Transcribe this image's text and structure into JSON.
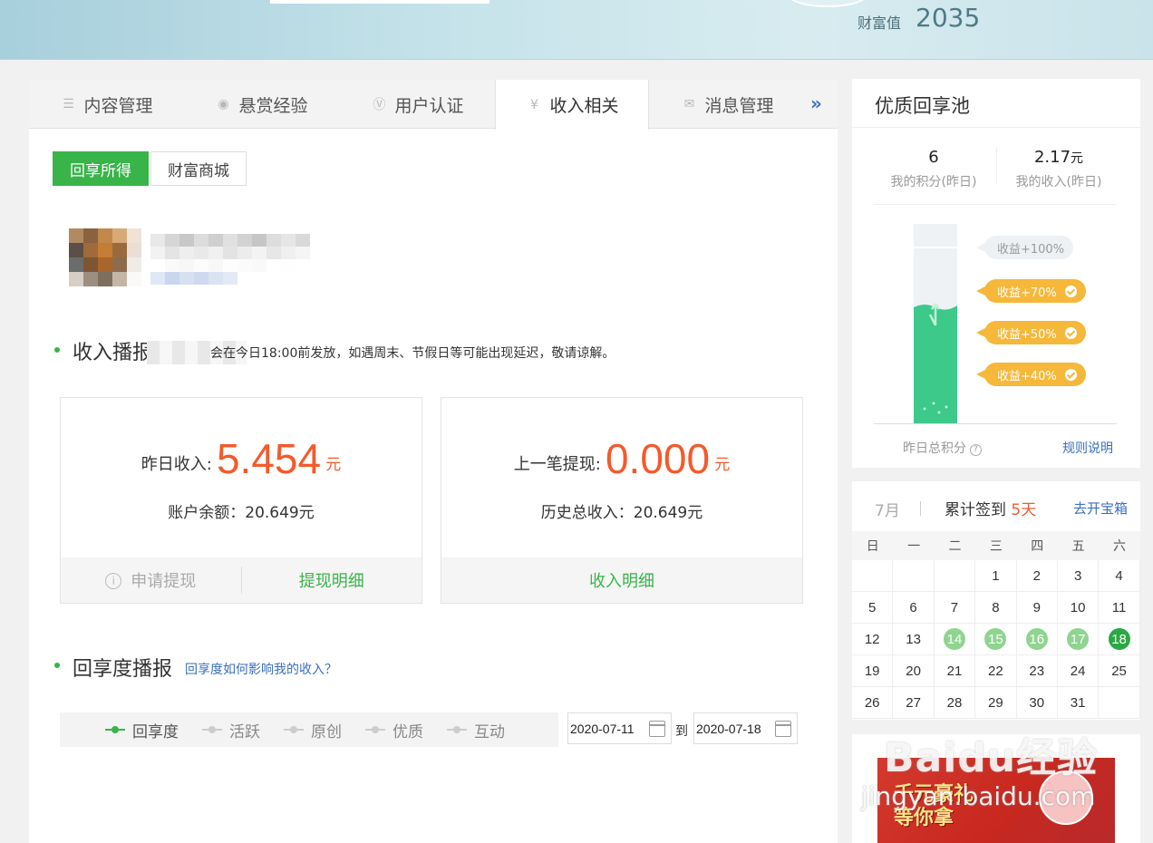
{
  "header": {
    "wealth_label": "财富值",
    "wealth_value": "2035"
  },
  "tabs": [
    {
      "label": "内容管理",
      "icon": "list-icon"
    },
    {
      "label": "悬赏经验",
      "icon": "bounty-icon"
    },
    {
      "label": "用户认证",
      "icon": "verify-icon"
    },
    {
      "label": "收入相关",
      "icon": "yen-icon",
      "active": true
    },
    {
      "label": "消息管理",
      "icon": "mail-icon"
    }
  ],
  "subtabs": {
    "earnings": "回享所得",
    "mall": "财富商城"
  },
  "income_section": {
    "title": "收入播报",
    "note": "会在今日18:00前发放，如遇周末、节假日等可能出现延迟，敬请谅解。"
  },
  "card_left": {
    "label": "昨日收入:",
    "value": "5.454",
    "unit": "元",
    "sub": "账户余额：20.649元",
    "btn_withdraw": "申请提现",
    "btn_detail": "提现明细"
  },
  "card_right": {
    "label": "上一笔提现:",
    "value": "0.000",
    "unit": "元",
    "sub": "历史总收入：20.649元",
    "btn_detail": "收入明细"
  },
  "degree_section": {
    "title": "回享度播报",
    "link": "回享度如何影响我的收入？"
  },
  "metrics": [
    "回享度",
    "活跃",
    "原创",
    "优质",
    "互动"
  ],
  "date_range": {
    "from": "2020-07-11",
    "to_label": "到",
    "to": "2020-07-18"
  },
  "pool": {
    "title": "优质回享池",
    "points_value": "6",
    "points_label": "我的积分(昨日)",
    "income_value": "2.17",
    "income_unit": "元",
    "income_label": "我的收入(昨日)",
    "fill_percent": 60,
    "tiers": [
      "收益+100%",
      "收益+70%",
      "收益+50%",
      "收益+40%"
    ],
    "foot_label": "昨日总积分",
    "rules": "规则说明"
  },
  "calendar": {
    "month": "7月",
    "sign_prefix": "累计签到",
    "sign_days": "5天",
    "open_box": "去开宝箱",
    "weekdays": [
      "日",
      "一",
      "二",
      "三",
      "四",
      "五",
      "六"
    ],
    "signed_days": [
      14,
      15,
      16,
      17
    ],
    "today": 18
  },
  "ad": {
    "line1": "千元豪礼",
    "line2": "等你拿"
  },
  "watermark": {
    "main": "Baidu经验",
    "sub": "jingyan.baidu.com"
  },
  "colors": {
    "green": "#38b449",
    "orange": "#f35a2c",
    "link": "#3a6fbd",
    "pill": "#f5b83b"
  }
}
